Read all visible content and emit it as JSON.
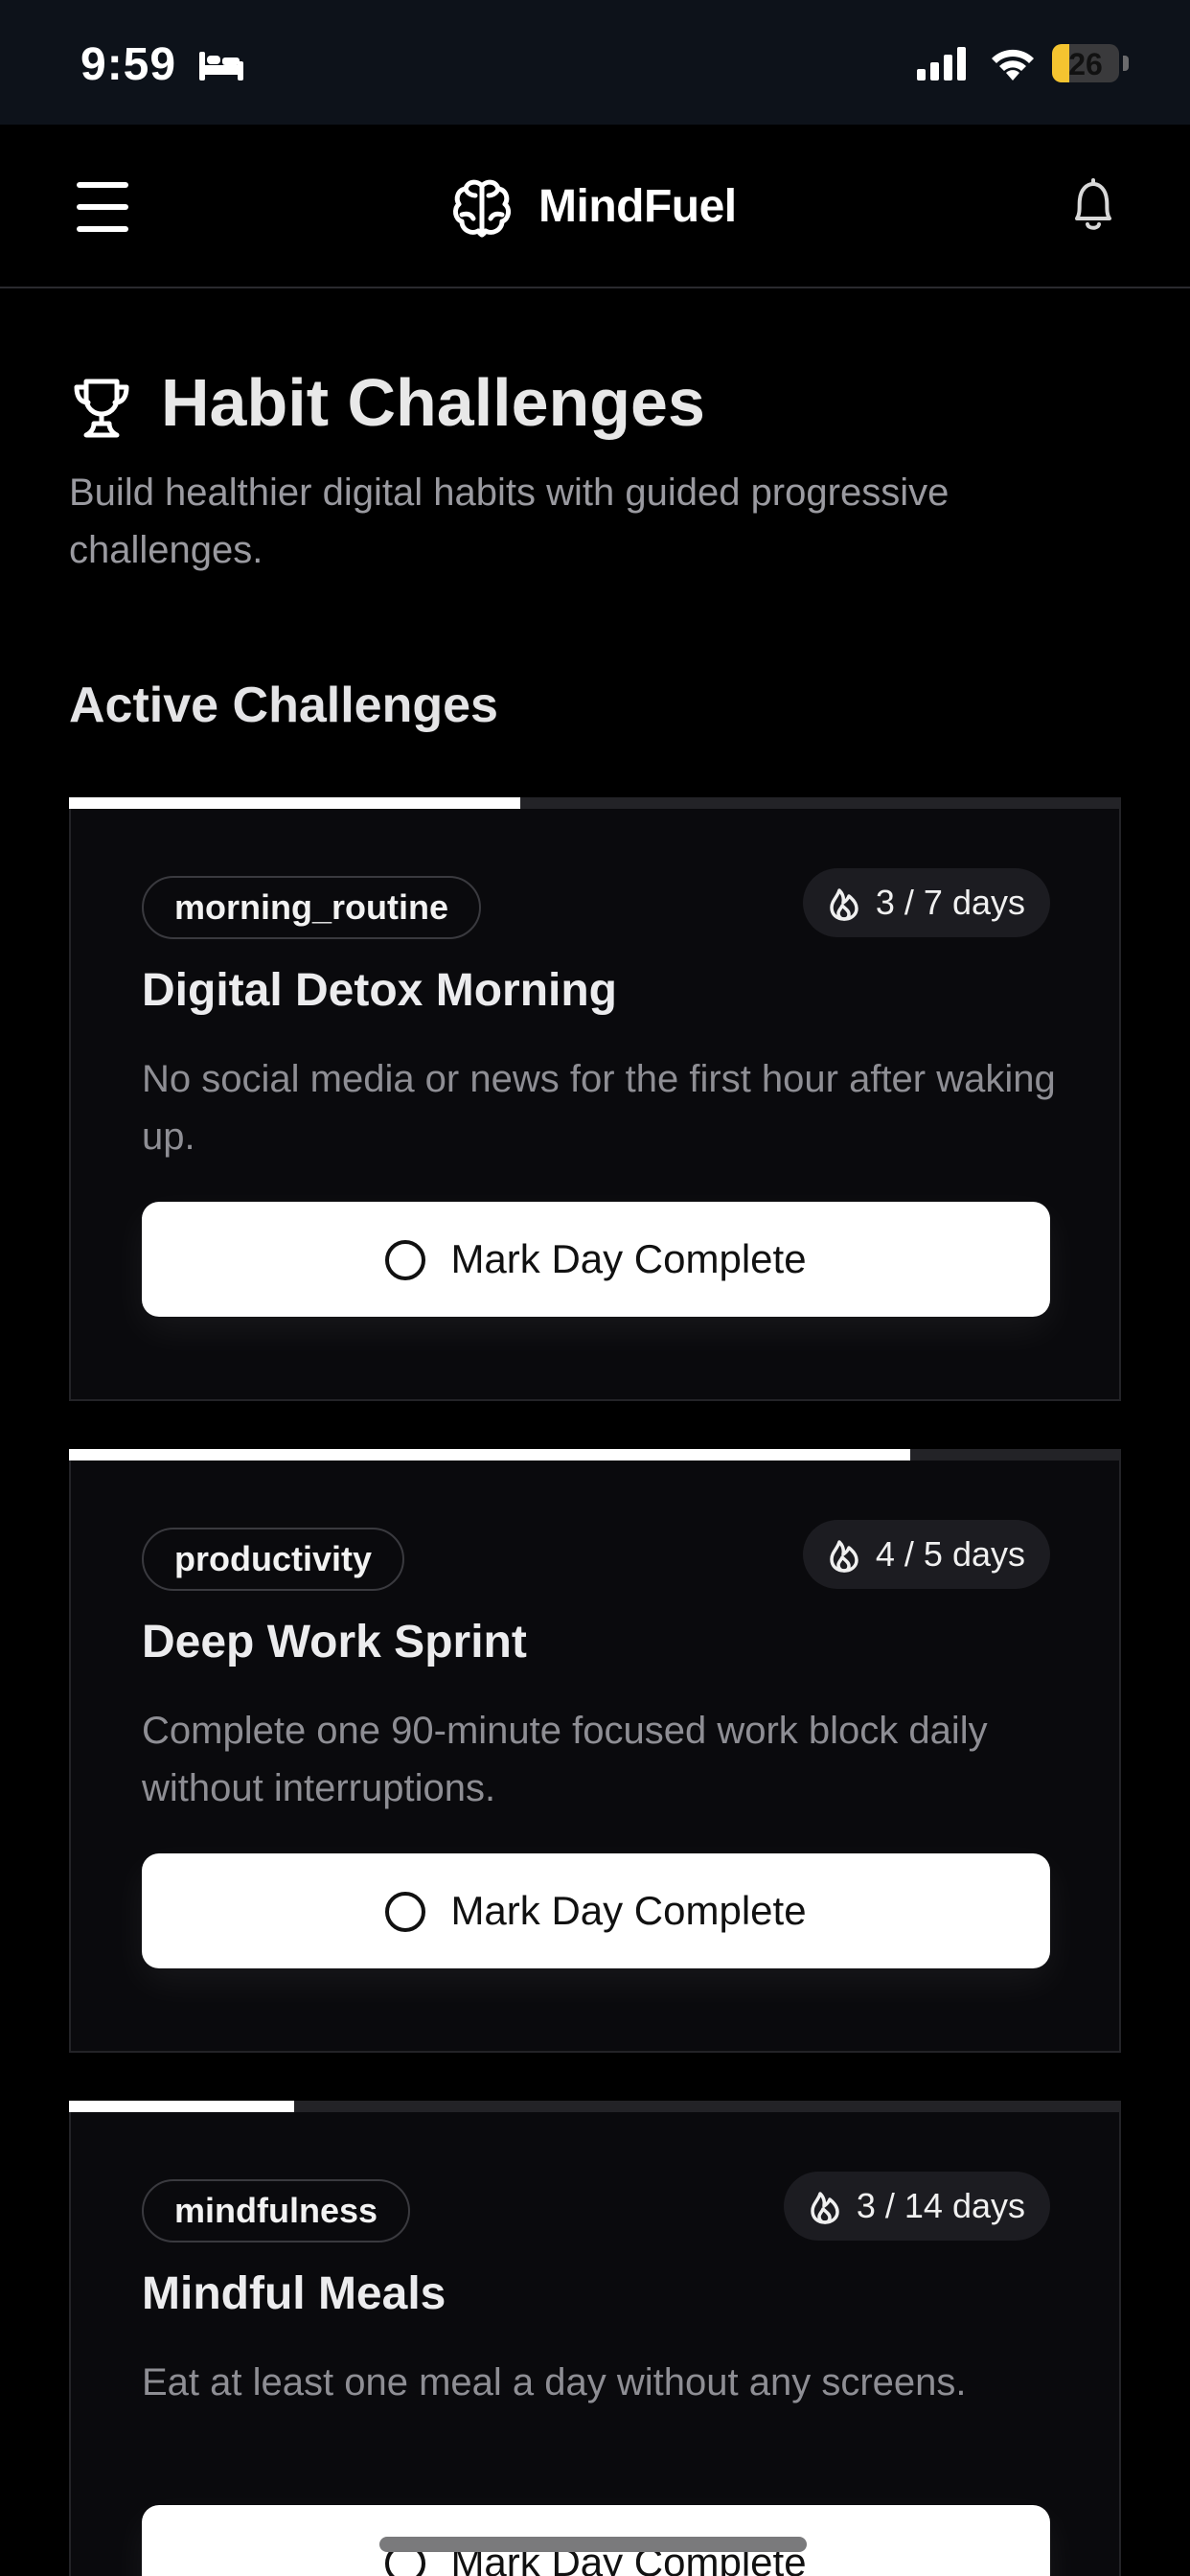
{
  "status_bar": {
    "time": "9:59",
    "battery_level": "26",
    "battery_fraction": 0.26,
    "icons": [
      "bed-icon",
      "signal-icon",
      "wifi-icon",
      "battery-icon"
    ]
  },
  "header": {
    "app_name": "MindFuel",
    "icons": [
      "menu-icon",
      "brain-icon",
      "bell-icon"
    ]
  },
  "page": {
    "title": "Habit Challenges",
    "subtitle": "Build healthier digital habits with guided progressive challenges.",
    "section_title": "Active Challenges"
  },
  "challenges": [
    {
      "tag": "morning_routine",
      "days_label": "3 / 7 days",
      "days_done": 3,
      "days_total": 7,
      "title": "Digital Detox Morning",
      "description": "No social media or news for the first hour after waking up.",
      "button_label": "Mark Day Complete"
    },
    {
      "tag": "productivity",
      "days_label": "4 / 5 days",
      "days_done": 4,
      "days_total": 5,
      "title": "Deep Work Sprint",
      "description": "Complete one 90-minute focused work block daily without interruptions.",
      "button_label": "Mark Day Complete"
    },
    {
      "tag": "mindfulness",
      "days_label": "3 / 14 days",
      "days_done": 3,
      "days_total": 14,
      "title": "Mindful Meals",
      "description": "Eat at least one meal a day without any screens.",
      "button_label": "Mark Day Complete"
    }
  ],
  "colors": {
    "background": "#000000",
    "status_bar": "#0d121a",
    "card": "#0a0a0d",
    "accent": "#ffffff",
    "battery": "#f4c430"
  }
}
